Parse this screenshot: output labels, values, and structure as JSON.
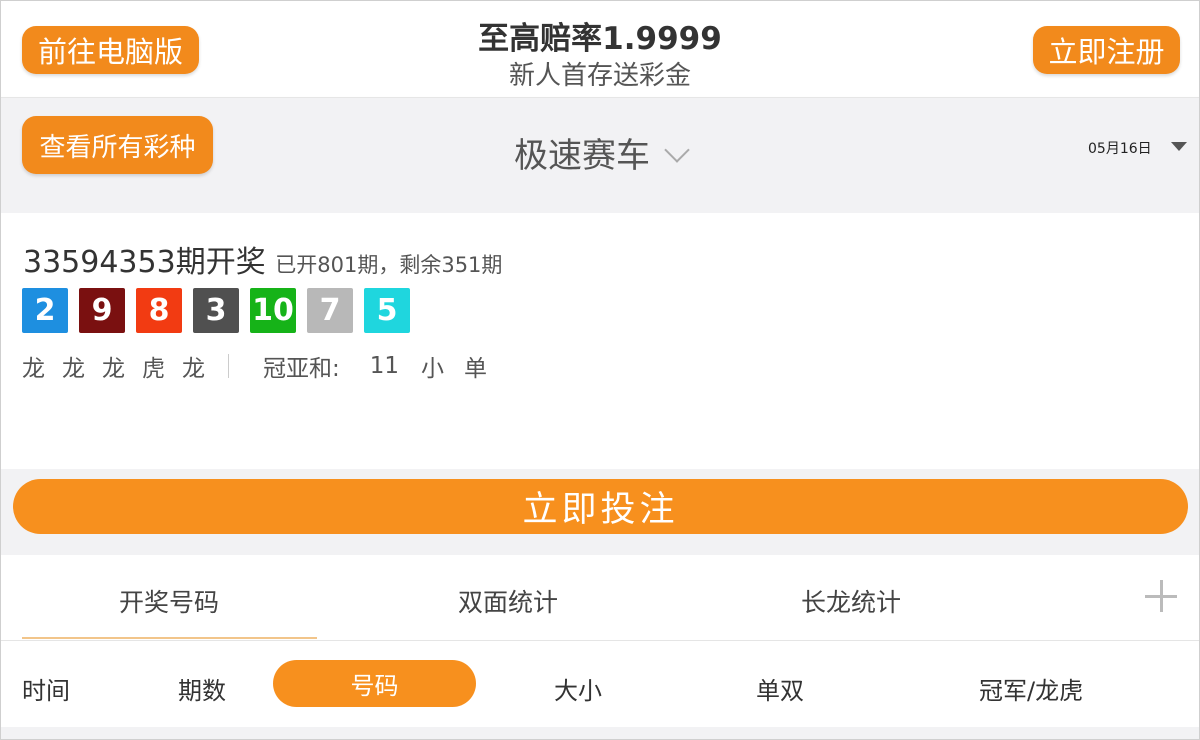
{
  "header": {
    "pc_button": "前往电脑版",
    "promo_title": "至高赔率1.9999",
    "promo_subtitle": "新人首存送彩金",
    "register_button": "立即注册"
  },
  "lottery_bar": {
    "all_button": "查看所有彩种",
    "selected_lottery": "极速赛车",
    "date": "05月16日"
  },
  "result": {
    "issue_title": "33594353期开奖",
    "issue_progress": "已开801期，剩余351期",
    "balls": [
      {
        "value": "2",
        "color": "#1e8fe0"
      },
      {
        "value": "9",
        "color": "#7a1010"
      },
      {
        "value": "8",
        "color": "#f23b12"
      },
      {
        "value": "3",
        "color": "#505050"
      },
      {
        "value": "10",
        "color": "#16b318"
      },
      {
        "value": "7",
        "color": "#b8b8b8"
      },
      {
        "value": "5",
        "color": "#1fd6de"
      }
    ],
    "dragon_tiger": [
      "龙",
      "龙",
      "龙",
      "虎",
      "龙"
    ],
    "sum_label": "冠亚和:",
    "sum_value": "11",
    "sum_size": "小",
    "sum_parity": "单"
  },
  "bet_button": "立即投注",
  "tabs": [
    "开奖号码",
    "双面统计",
    "长龙统计"
  ],
  "sub_tabs": {
    "time": "时间",
    "issue": "期数",
    "number": "号码",
    "size": "大小",
    "parity": "单双",
    "champion": "冠军/龙虎"
  },
  "colors": {
    "accent": "#f7901e",
    "background_gray": "#f2f2f4"
  }
}
